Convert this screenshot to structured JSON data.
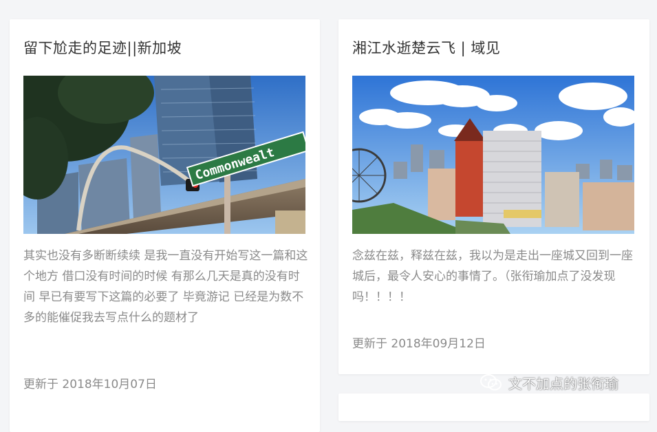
{
  "posts": [
    {
      "title": "留下尬走的足迹||新加坡",
      "excerpt": "其实也没有多断断续续 是我一直没有开始写这一篇和这个地方 借口没有时间的时候 有那么几天是真的没有时间 早已有要写下这篇的必要了 毕竟游记 已经是为数不多的能催促我去写点什么的题材了",
      "updated": "更新于 2018年10月07日",
      "sign_text": "Commonwealt"
    },
    {
      "title": "湘江水逝楚云飞 | 域见",
      "excerpt": "念兹在兹，释兹在兹，我以为是走出一座城又回到一座城后，最令人安心的事情了。（张衔瑜加点了没发现吗！！！！",
      "updated": "更新于 2018年09月12日"
    }
  ],
  "watermark": {
    "icon": "wechat-icon",
    "text": "文不加点的张衔瑜"
  }
}
